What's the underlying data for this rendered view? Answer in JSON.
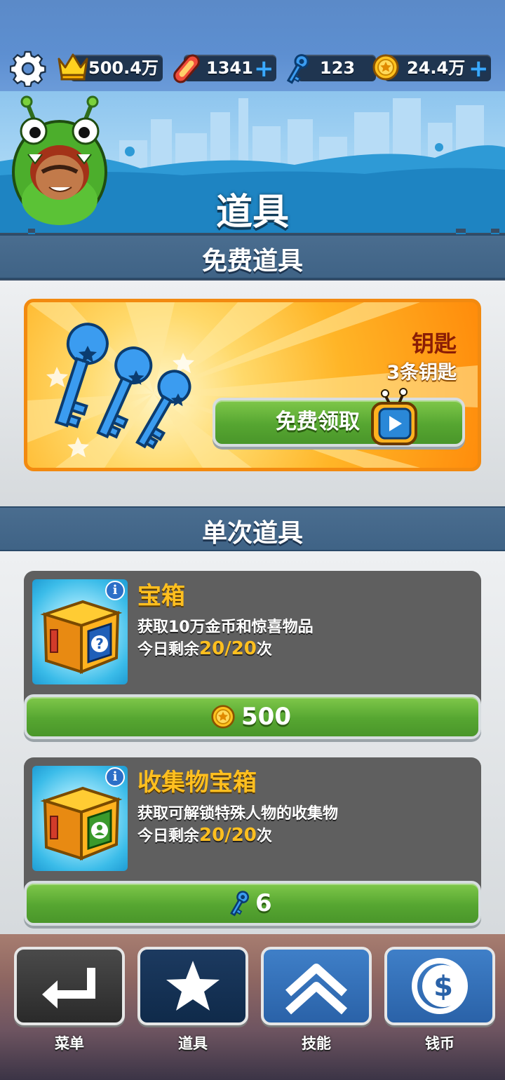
{
  "topbar": {
    "score": "500.4万",
    "hoverboards": "1341",
    "keys": "123",
    "coins": "24.4万"
  },
  "header": {
    "title": "道具"
  },
  "free_section": {
    "title": "免费道具",
    "item_name": "钥匙",
    "item_desc": "3条钥匙",
    "claim_label": "免费领取"
  },
  "single_section": {
    "title": "单次道具",
    "items": [
      {
        "name": "宝箱",
        "desc": "获取10万金币和惊喜物品",
        "left_prefix": "今日剩余",
        "left_count": "20/20",
        "left_suffix": "次",
        "price": "500",
        "currency_icon": "coin-icon"
      },
      {
        "name": "收集物宝箱",
        "desc": "获取可解锁特殊人物的收集物",
        "left_prefix": "今日剩余",
        "left_count": "20/20",
        "left_suffix": "次",
        "price": "6",
        "currency_icon": "key-icon"
      }
    ]
  },
  "bottom_nav": {
    "items": [
      {
        "label": "菜单",
        "icon": "return-arrow-icon"
      },
      {
        "label": "道具",
        "icon": "star-icon"
      },
      {
        "label": "技能",
        "icon": "double-chevron-up-icon"
      },
      {
        "label": "钱币",
        "icon": "dollar-coin-icon"
      }
    ]
  },
  "colors": {
    "accent_orange": "#f28a10",
    "button_green": "#56a631",
    "gold_text": "#ffbf1f",
    "section_blue": "#3f6386"
  }
}
